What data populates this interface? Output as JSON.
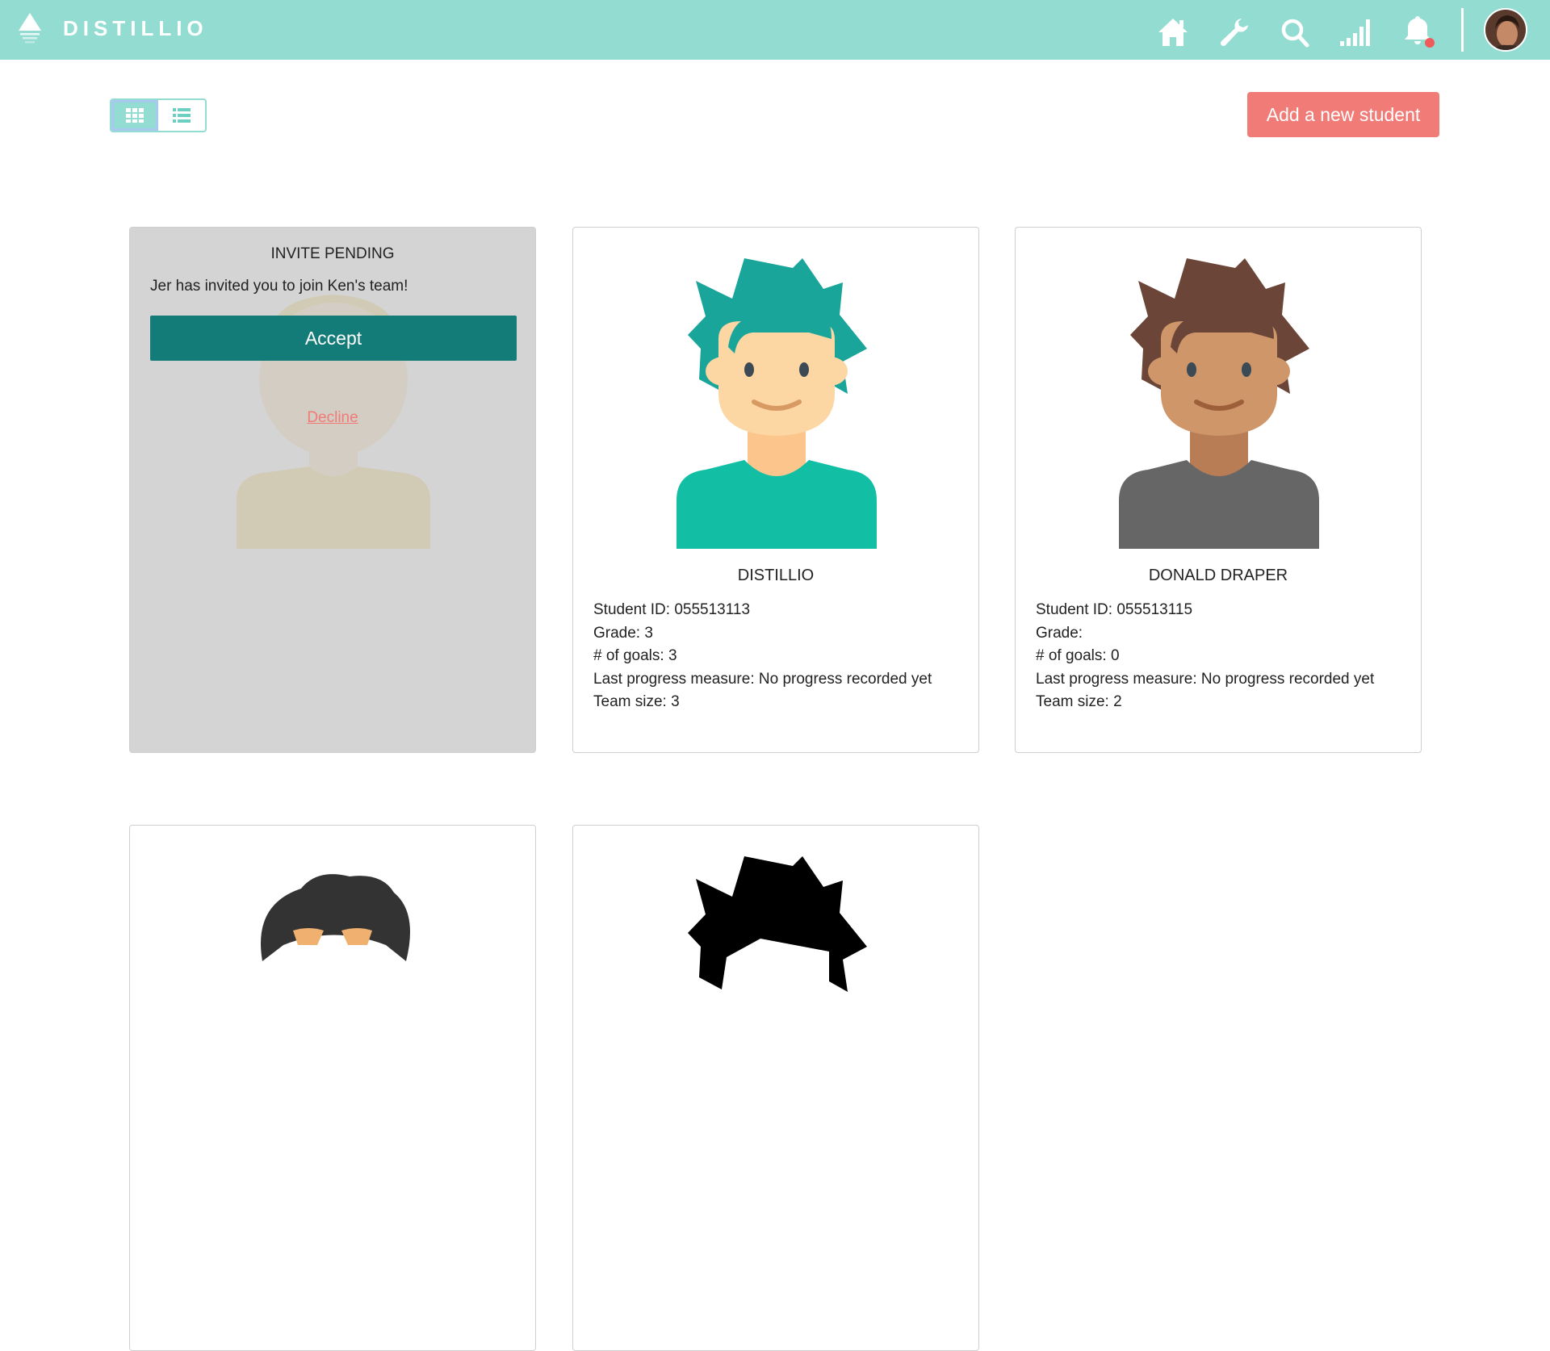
{
  "app": {
    "name": "DISTILLIO"
  },
  "topbar": {
    "icons": [
      "home-icon",
      "wrench-icon",
      "search-icon",
      "signal-icon",
      "bell-icon"
    ],
    "accent": "#93dcd1",
    "notification_dot": "#f05a5a"
  },
  "toolbar": {
    "add_label": "Add a new student",
    "add_color": "#f07b77"
  },
  "invite": {
    "title": "INVITE PENDING",
    "message": "Jer has invited you to join Ken's team!",
    "accept_label": "Accept",
    "decline_label": "Decline",
    "accept_color": "#137c79"
  },
  "students": [
    {
      "name": "DISTILLIO",
      "student_id": "Student ID: 055513113",
      "grade": "Grade: 3",
      "goals": "# of goals: 3",
      "last_progress": "Last progress measure: No progress recorded yet",
      "team_size": "Team size: 3",
      "hair_color": "#1aa59b",
      "skin_color": "#fdd7a3",
      "shirt_color": "#12bfa4"
    },
    {
      "name": "DONALD DRAPER",
      "student_id": "Student ID: 055513115",
      "grade": "Grade:",
      "goals": "# of goals: 0",
      "last_progress": "Last progress measure: No progress recorded yet",
      "team_size": "Team size: 2",
      "hair_color": "#6b4638",
      "skin_color": "#cf966a",
      "shirt_color": "#666666"
    }
  ]
}
